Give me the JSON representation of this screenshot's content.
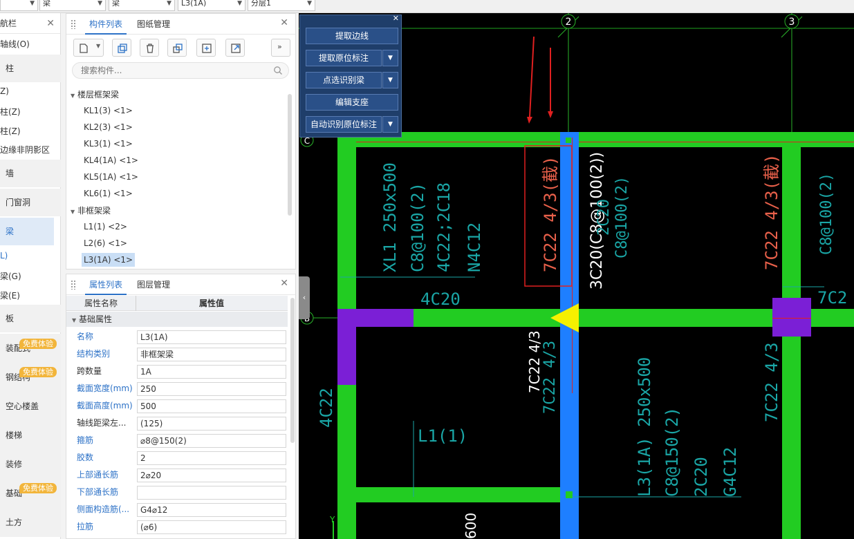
{
  "topbar": {
    "selects": [
      "",
      "梁",
      "梁",
      "L3(1A)",
      "分层1"
    ]
  },
  "nav": {
    "title": "航栏",
    "items": [
      {
        "label": "轴线(O)"
      },
      {
        "label": "柱"
      },
      {
        "label": "Z)"
      },
      {
        "label": "柱(Z)"
      },
      {
        "label": "柱(Z)"
      },
      {
        "label": "边缘非阴影区"
      },
      {
        "label": "墙"
      },
      {
        "label": "门窗洞"
      },
      {
        "label": "梁"
      },
      {
        "label": "L)"
      },
      {
        "label": "梁(G)"
      },
      {
        "label": "梁(E)"
      },
      {
        "label": "板"
      },
      {
        "label": "装配式"
      },
      {
        "label": "钢结构"
      },
      {
        "label": "空心楼盖"
      },
      {
        "label": "楼梯"
      },
      {
        "label": "装修"
      },
      {
        "label": "基础"
      },
      {
        "label": "土方"
      }
    ],
    "badge_label": "免费体验"
  },
  "component_list": {
    "tabs": [
      "构件列表",
      "图纸管理"
    ],
    "search_placeholder": "搜索构件...",
    "groups": [
      {
        "label": "楼层框架梁",
        "items": [
          "KL1(3) <1>",
          "KL2(3) <1>",
          "KL3(1) <1>",
          "KL4(1A) <1>",
          "KL5(1A) <1>",
          "KL6(1) <1>"
        ]
      },
      {
        "label": "非框架梁",
        "items": [
          "L1(1) <2>",
          "L2(6) <1>",
          "L3(1A) <1>"
        ]
      }
    ]
  },
  "properties": {
    "tabs": [
      "属性列表",
      "图层管理"
    ],
    "header_name": "属性名称",
    "header_value": "属性值",
    "section": "基础属性",
    "rows": [
      {
        "name": "名称",
        "value": "L3(1A)",
        "blue": true
      },
      {
        "name": "结构类别",
        "value": "非框架梁",
        "blue": true
      },
      {
        "name": "跨数量",
        "value": "1A",
        "blue": false
      },
      {
        "name": "截面宽度(mm)",
        "value": "250",
        "blue": true
      },
      {
        "name": "截面高度(mm)",
        "value": "500",
        "blue": true
      },
      {
        "name": "轴线距梁左...",
        "value": "(125)",
        "blue": false
      },
      {
        "name": "箍筋",
        "value": "⌀8@150(2)",
        "blue": true
      },
      {
        "name": "胶数",
        "value": "2",
        "blue": true
      },
      {
        "name": "上部通长筋",
        "value": "2⌀20",
        "blue": true
      },
      {
        "name": "下部通长筋",
        "value": "",
        "blue": true
      },
      {
        "name": "侧面构造筋(...",
        "value": "G4⌀12",
        "blue": true
      },
      {
        "name": "拉筋",
        "value": "(⌀6)",
        "blue": true
      }
    ]
  },
  "float_panel": {
    "buttons": [
      "提取边线",
      "提取原位标注",
      "点选识别梁",
      "编辑支座",
      "自动识别原位标注"
    ]
  },
  "drawing": {
    "axis_labels": [
      "2",
      "3",
      "C",
      "B",
      "Y"
    ],
    "annotations": {
      "xl1": "XL1 250x500",
      "xl1_stirrup": "C8@100(2)",
      "xl1_top": "4C22;2C18",
      "xl1_side": "N4C12",
      "mid_4c20": "4C20",
      "sel_7c22": "7C22 4/3(截)",
      "beam_3c20": "3C20(C8@100(2))",
      "c8_2": "C8@100(2)",
      "beam_2c20": "2C20",
      "right_7c22": "7C22 4/3(截)",
      "right_c8": "C8@100(2)",
      "right_7c2": "7C2",
      "mid_7c22_white": "7C22 4/3",
      "mid_7c22_cyan": "7C22 4/3",
      "left_4c22": "4C22",
      "l1": "L1(1)",
      "l3_1a": "L3(1A) 250x500",
      "l3_stirrup": "C8@150(2)",
      "l3_top": "2C20",
      "l3_side": "G4C12",
      "right_7c22_lower": "7C22 4/3",
      "bottom_600": "600"
    }
  }
}
